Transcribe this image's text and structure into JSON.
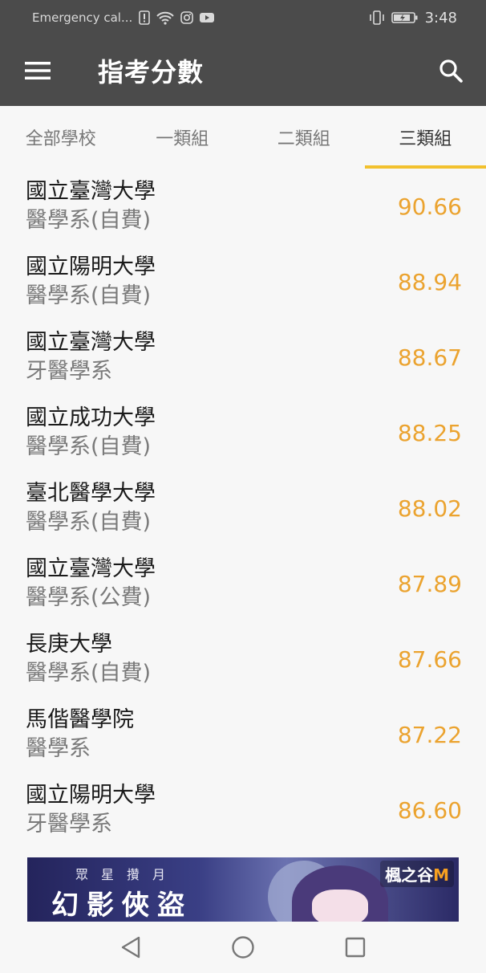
{
  "status_bar": {
    "carrier_text": "Emergency cal...",
    "time": "3:48",
    "icons": [
      "sim-alert-icon",
      "wifi-icon",
      "instagram-icon",
      "youtube-icon",
      "vibrate-icon",
      "battery-icon"
    ]
  },
  "app_bar": {
    "title": "指考分數",
    "menu_icon": "hamburger-menu-icon",
    "search_icon": "search-icon"
  },
  "tabs": [
    {
      "label": "全部學校",
      "active": false
    },
    {
      "label": "一類組",
      "active": false
    },
    {
      "label": "二類組",
      "active": false
    },
    {
      "label": "三類組",
      "active": true
    }
  ],
  "results": [
    {
      "school": "國立臺灣大學",
      "department": "醫學系(自費)",
      "score": "90.66"
    },
    {
      "school": "國立陽明大學",
      "department": "醫學系(自費)",
      "score": "88.94"
    },
    {
      "school": "國立臺灣大學",
      "department": "牙醫學系",
      "score": "88.67"
    },
    {
      "school": "國立成功大學",
      "department": "醫學系(自費)",
      "score": "88.25"
    },
    {
      "school": "臺北醫學大學",
      "department": "醫學系(自費)",
      "score": "88.02"
    },
    {
      "school": "國立臺灣大學",
      "department": "醫學系(公費)",
      "score": "87.89"
    },
    {
      "school": "長庚大學",
      "department": "醫學系(自費)",
      "score": "87.66"
    },
    {
      "school": "馬偕醫學院",
      "department": "醫學系",
      "score": "87.22"
    },
    {
      "school": "國立陽明大學",
      "department": "牙醫學系",
      "score": "86.60"
    }
  ],
  "ad": {
    "subtitle": "眾星攢月",
    "title": "幻影俠盜",
    "logo_text": "楓之谷",
    "logo_m": "M"
  },
  "nav_bar": {
    "icons": [
      "back-icon",
      "home-icon",
      "recents-icon"
    ]
  },
  "colors": {
    "app_bar": "#4b4b4b",
    "accent": "#f2c12e",
    "score": "#eba32f"
  }
}
